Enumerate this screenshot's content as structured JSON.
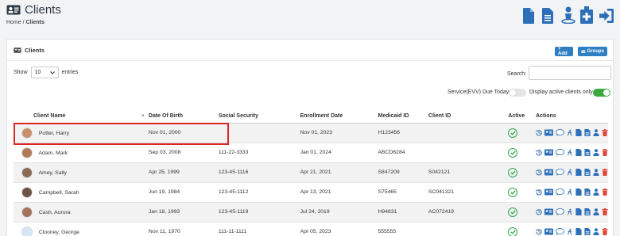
{
  "header": {
    "title": "Clients",
    "breadcrumb_home": "Home",
    "breadcrumb_sep": "/",
    "breadcrumb_current": "Clients",
    "top_icons": [
      "document-icon",
      "list-document-icon",
      "person-location-icon",
      "medical-kit-icon",
      "sign-in-icon"
    ]
  },
  "card": {
    "title": "Clients",
    "add_label": "+ Add",
    "groups_label": "Groups",
    "show_label": "Show",
    "entries_value": "10",
    "entries_label": "entries",
    "search_label": "Search:",
    "search_value": "",
    "toggle_evv_label": "Service(EVV) Due Today",
    "toggle_evv_on": false,
    "toggle_active_label": "Display active clients only",
    "toggle_active_on": true
  },
  "table": {
    "columns": [
      "Client Name",
      "Date Of Birth",
      "Social Security",
      "Enrollment Date",
      "Medicaid ID",
      "Client ID",
      "Active",
      "Actions"
    ],
    "rows": [
      {
        "name": "Potter, Harry",
        "dob": "Nov 01, 2000",
        "ssn": "",
        "enrollment": "Nov 01, 2023",
        "medicaid": "H123456",
        "client_id": "",
        "active": true
      },
      {
        "name": "Adam, Mark",
        "dob": "Sep 03, 2008",
        "ssn": "111-22-3333",
        "enrollment": "Jan 01, 2024",
        "medicaid": "ABCD6284",
        "client_id": "",
        "active": true
      },
      {
        "name": "Amey, Sally",
        "dob": "Apr 25, 1999",
        "ssn": "123-45-1116",
        "enrollment": "Apr 21, 2021",
        "medicaid": "S847209",
        "client_id": "S042121",
        "active": true
      },
      {
        "name": "Campbell, Sarah",
        "dob": "Jun 19, 1984",
        "ssn": "123-45-1112",
        "enrollment": "Apr 13, 2021",
        "medicaid": "S75465",
        "client_id": "SC041321",
        "active": true
      },
      {
        "name": "Cash, Aurora",
        "dob": "Jan 18, 1993",
        "ssn": "123-45-1119",
        "enrollment": "Jul 24, 2019",
        "medicaid": "H94831",
        "client_id": "AC072419",
        "active": true
      },
      {
        "name": "Clooney, George",
        "dob": "Nov 11, 1970",
        "ssn": "111-11-1111",
        "enrollment": "Apr 05, 2023",
        "medicaid": "555555",
        "client_id": "",
        "active": true
      }
    ]
  },
  "colors": {
    "accent": "#2d7fc2",
    "active_green": "#2aa84a",
    "delete_red": "#e0443a",
    "highlight_red": "#e02424"
  }
}
